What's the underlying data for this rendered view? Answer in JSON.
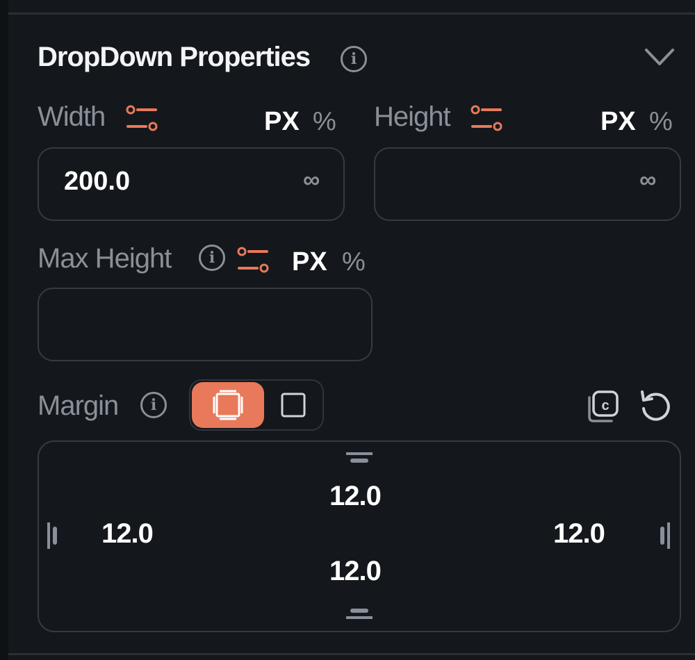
{
  "panel": {
    "title": "DropDown Properties",
    "accent_color": "#e8795a"
  },
  "width": {
    "label": "Width",
    "unit_px": "PX",
    "unit_percent": "%",
    "value": "200.0",
    "link_symbol": "∞"
  },
  "height": {
    "label": "Height",
    "unit_px": "PX",
    "unit_percent": "%",
    "value": "",
    "link_symbol": "∞"
  },
  "max_height": {
    "label": "Max Height",
    "unit_px": "PX",
    "unit_percent": "%",
    "value": ""
  },
  "margin": {
    "label": "Margin",
    "top": "12.0",
    "bottom": "12.0",
    "left": "12.0",
    "right": "12.0"
  },
  "icons": {
    "info": "info-icon",
    "collapse": "chevron-down-icon",
    "responsive": "sliders-icon",
    "copy": "copy-icon",
    "reset": "reset-icon"
  }
}
